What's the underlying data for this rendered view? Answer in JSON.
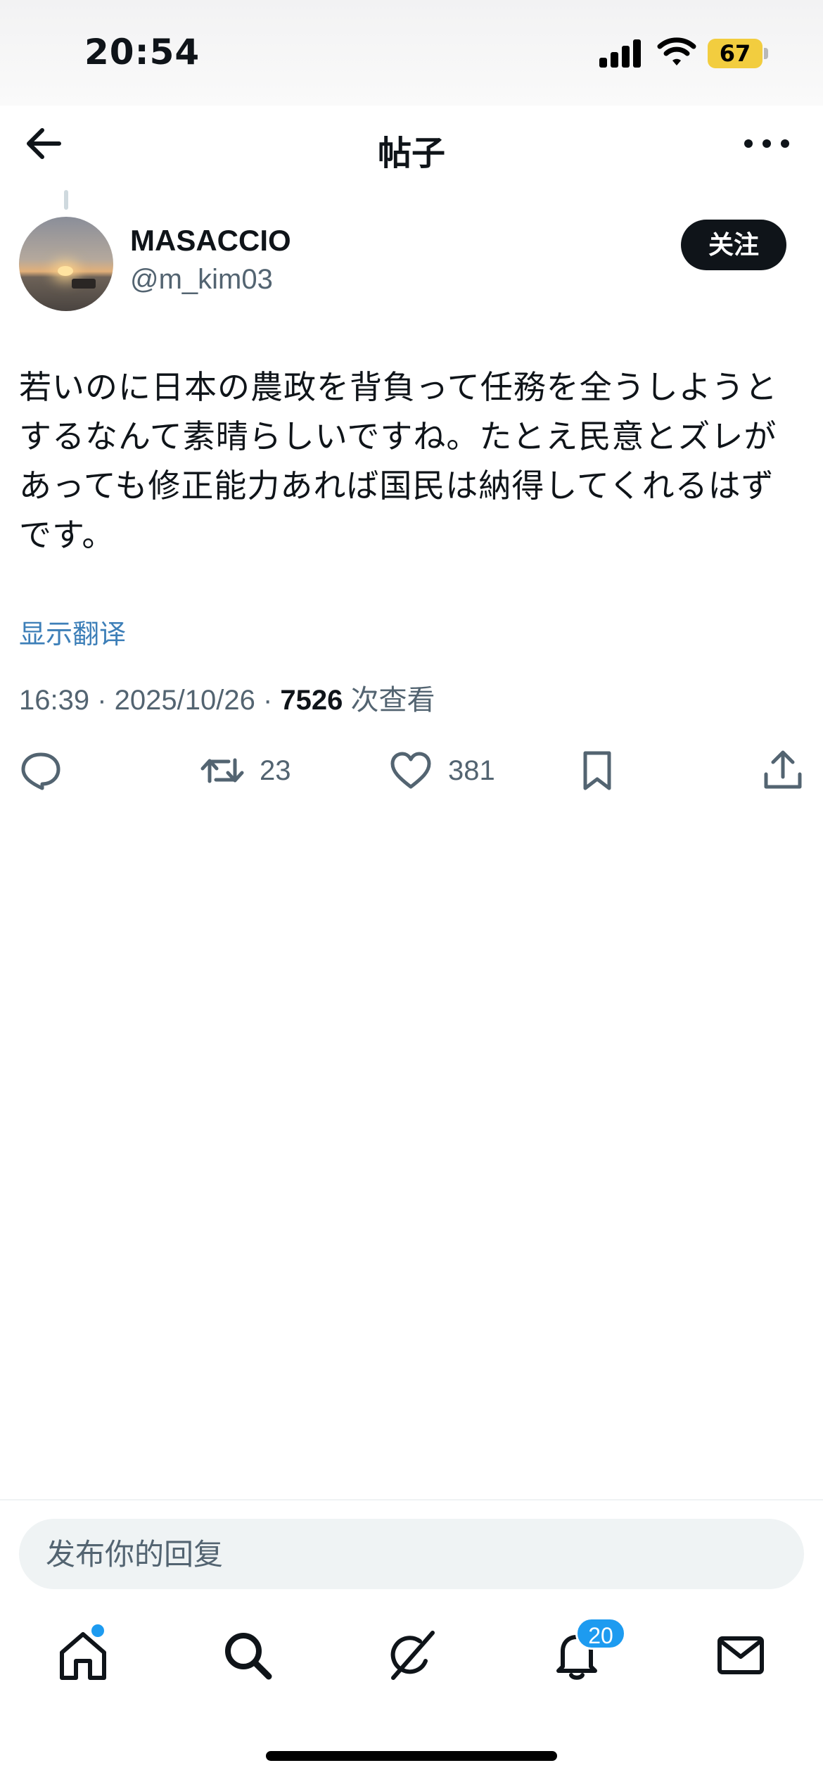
{
  "status_bar": {
    "time": "20:54",
    "battery": "67"
  },
  "nav": {
    "title": "帖子"
  },
  "post": {
    "display_name": "MASACCIO",
    "handle": "@m_kim03",
    "follow_label": "关注",
    "text": "若いのに日本の農政を背負って任務を全うしようとするなんて素晴らしいですね。たとえ民意とズレがあっても修正能力あれば国民は納得してくれるはずです。",
    "translate_label": "显示翻译",
    "time": "16:39",
    "date": "2025/10/26",
    "views": "7526",
    "views_label": "次查看",
    "retweets": "23",
    "likes": "381"
  },
  "reply": {
    "placeholder": "发布你的回复"
  },
  "tabbar": {
    "notifications_badge": "20"
  },
  "colors": {
    "accent": "#1d9bf0",
    "text": "#0f1419",
    "muted": "#536471",
    "battery": "#f2cd3f"
  },
  "icons": [
    "back-arrow-icon",
    "more-icon",
    "reply-icon",
    "retweet-icon",
    "like-icon",
    "bookmark-icon",
    "share-icon",
    "home-icon",
    "search-icon",
    "grok-icon",
    "bell-icon",
    "mail-icon"
  ]
}
